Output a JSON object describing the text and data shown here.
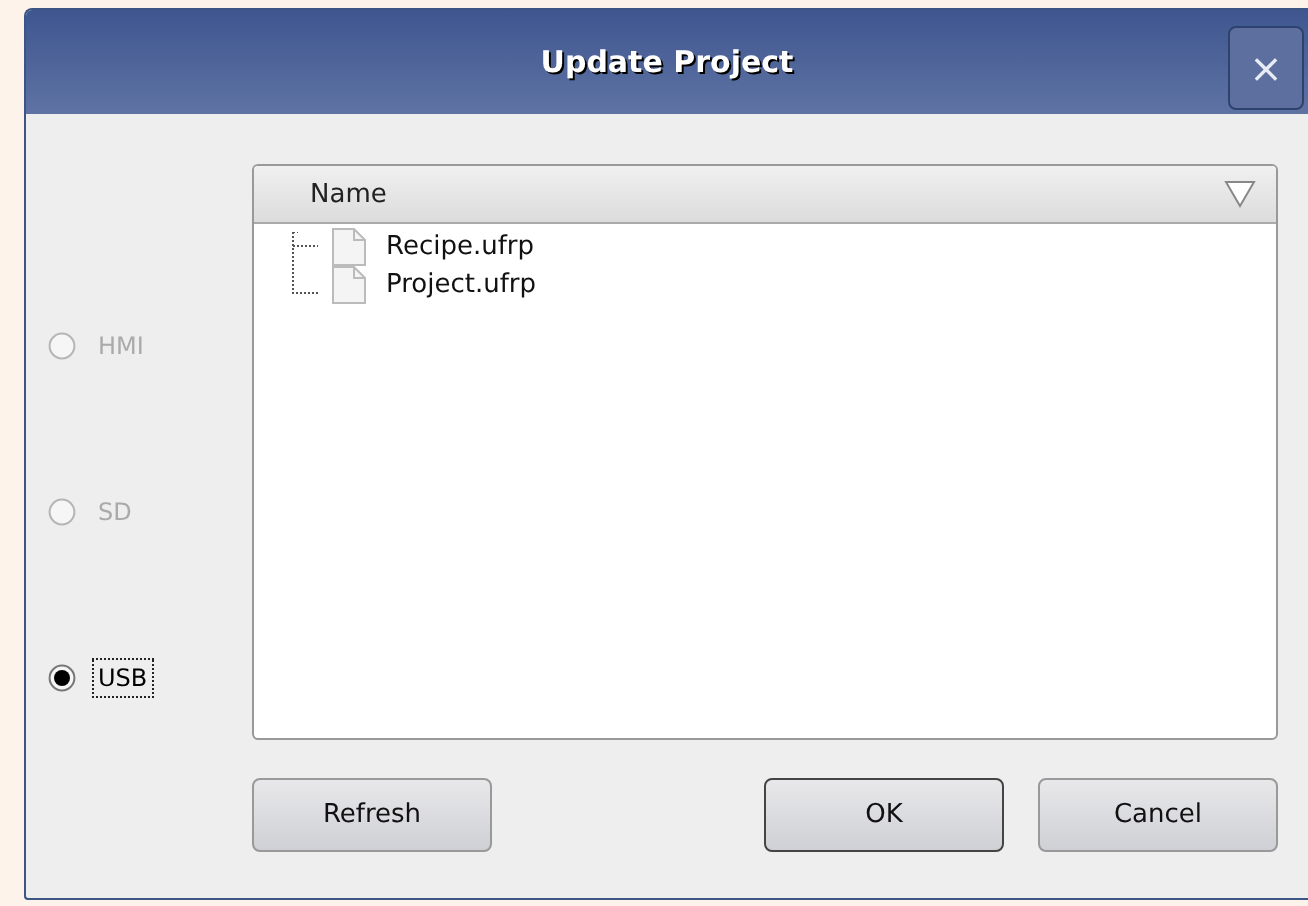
{
  "window": {
    "title": "Update Project",
    "close": "×"
  },
  "sources": [
    {
      "label": "HMI",
      "selected": false,
      "disabled": true
    },
    {
      "label": "SD",
      "selected": false,
      "disabled": true
    },
    {
      "label": "USB",
      "selected": true,
      "disabled": false
    }
  ],
  "file_list": {
    "columns": [
      "Name"
    ],
    "items": [
      {
        "name": "Recipe.ufrp"
      },
      {
        "name": "Project.ufrp"
      }
    ]
  },
  "buttons": [
    {
      "label": "Refresh",
      "default": false
    },
    {
      "label": "OK",
      "default": true
    },
    {
      "label": "Cancel",
      "default": false
    }
  ]
}
